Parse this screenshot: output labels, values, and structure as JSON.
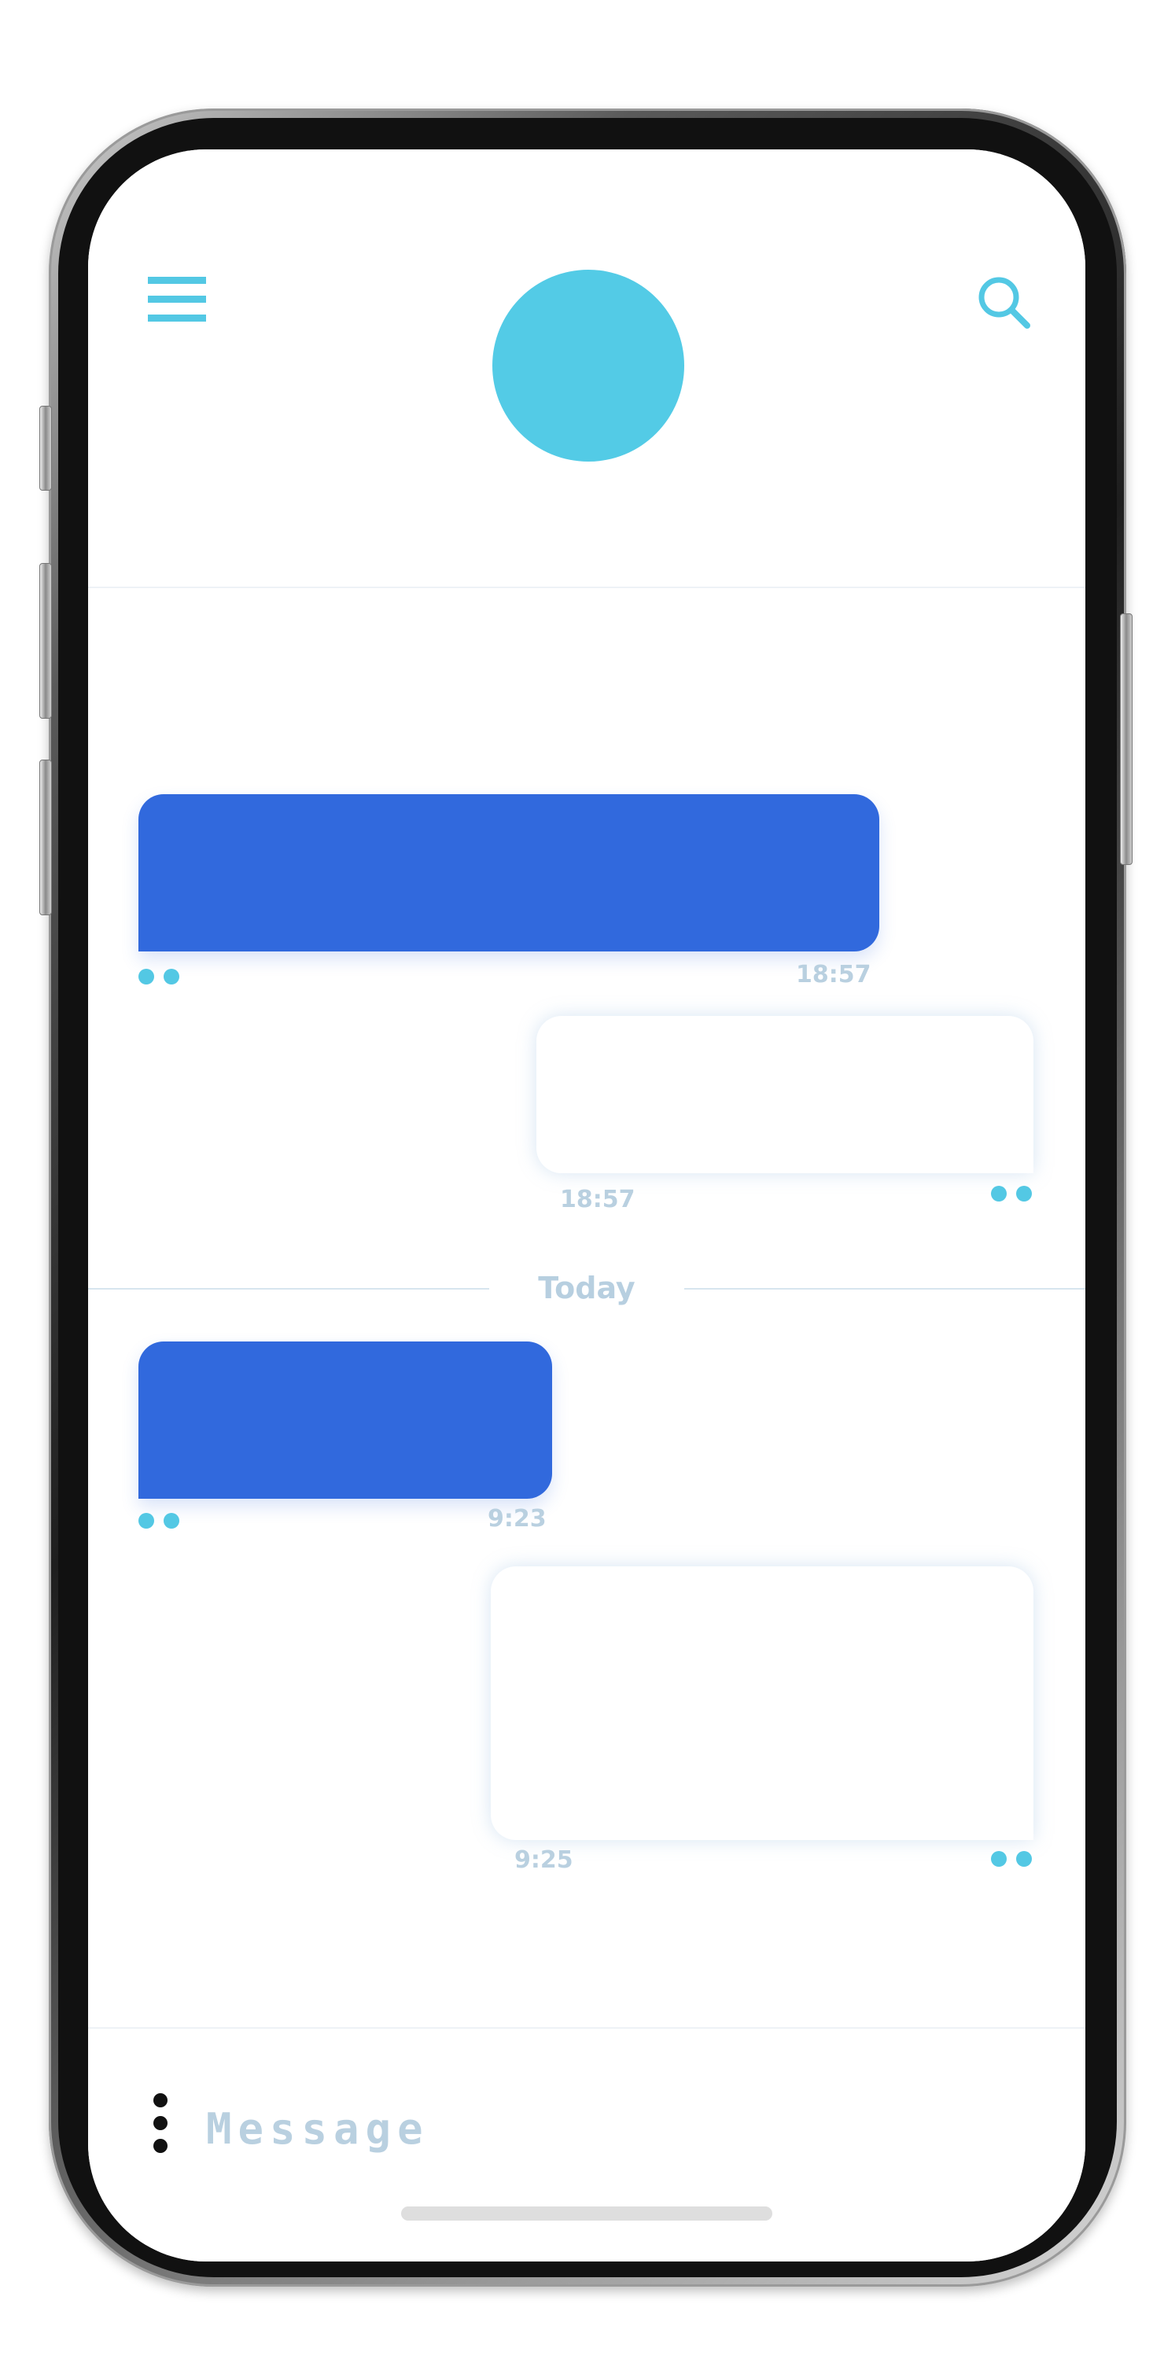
{
  "header": {
    "menu_icon": "hamburger-menu-icon",
    "search_icon": "search-icon",
    "avatar_color": "#53cbe6"
  },
  "colors": {
    "accent": "#53c8e4",
    "incoming_bubble": "#3169dd",
    "outgoing_bubble": "#ffffff",
    "muted_text": "#b9d0e0"
  },
  "messages": [
    {
      "direction": "incoming",
      "time": "18:57"
    },
    {
      "direction": "outgoing",
      "time": "18:57"
    },
    {
      "direction": "incoming",
      "time": "9:23"
    },
    {
      "direction": "outgoing",
      "time": "9:25"
    }
  ],
  "divider": {
    "label": "Today"
  },
  "composer": {
    "more_icon": "vertical-dots-icon",
    "placeholder": "Message"
  }
}
